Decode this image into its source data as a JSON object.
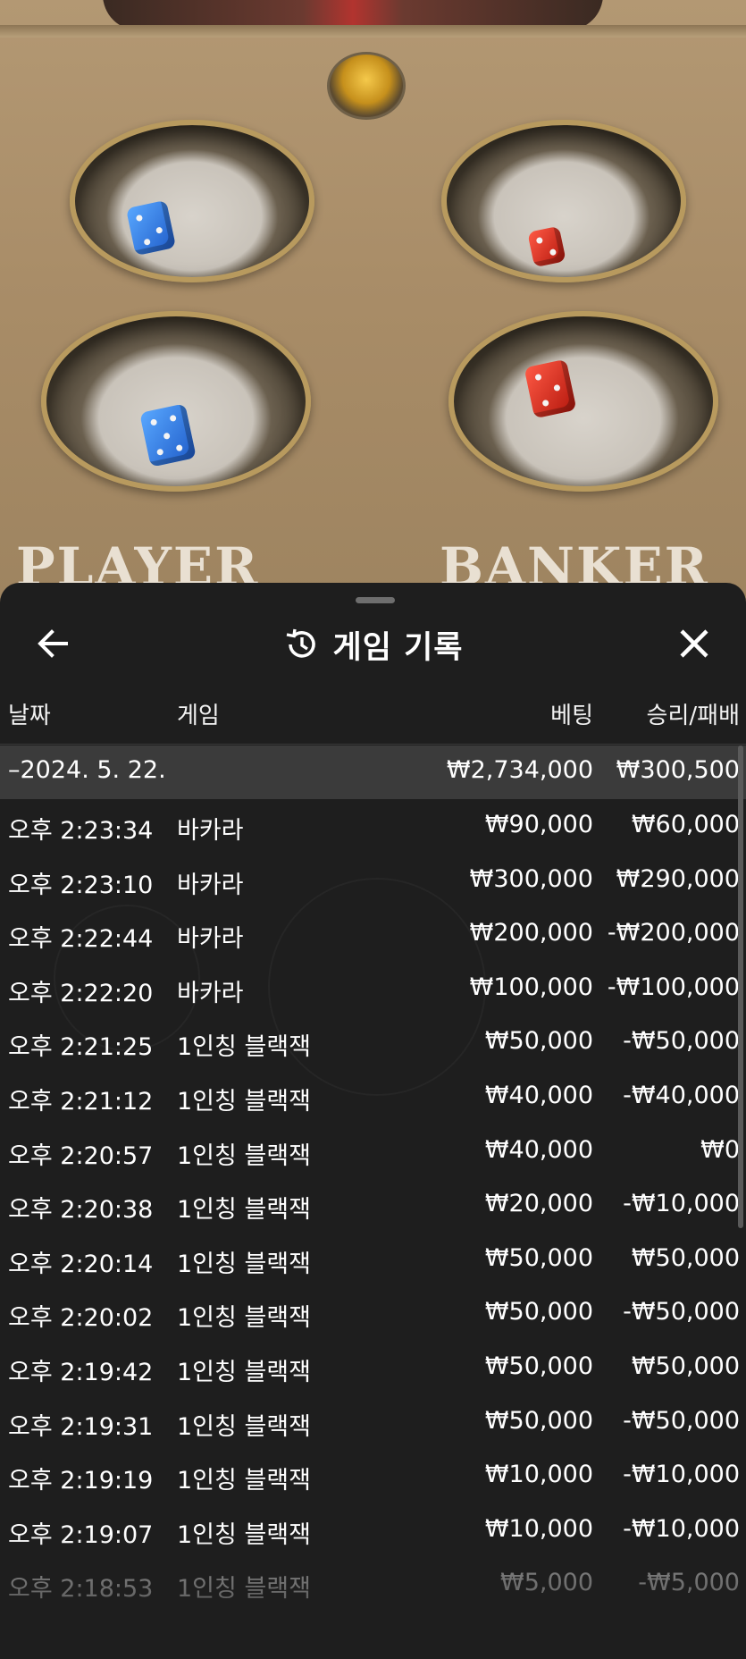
{
  "table": {
    "player_text": "PLAYER",
    "banker_text": "BANKER"
  },
  "sheet": {
    "title": "게임 기록",
    "icons": {
      "back": "arrow-left-icon",
      "history": "history-icon",
      "close": "close-icon"
    },
    "columns": {
      "date": "날짜",
      "game": "게임",
      "bet": "베팅",
      "win_loss": "승리/패배"
    },
    "date_group": {
      "label": "–2024. 5. 22.",
      "bet_total": "₩2,734,000",
      "win_total": "₩300,500"
    },
    "rows": [
      {
        "time": "오후 2:23:34",
        "game": "바카라",
        "bet": "₩90,000",
        "result": "₩60,000"
      },
      {
        "time": "오후 2:23:10",
        "game": "바카라",
        "bet": "₩300,000",
        "result": "₩290,000"
      },
      {
        "time": "오후 2:22:44",
        "game": "바카라",
        "bet": "₩200,000",
        "result": "-₩200,000"
      },
      {
        "time": "오후 2:22:20",
        "game": "바카라",
        "bet": "₩100,000",
        "result": "-₩100,000"
      },
      {
        "time": "오후 2:21:25",
        "game": "1인칭 블랙잭",
        "bet": "₩50,000",
        "result": "-₩50,000"
      },
      {
        "time": "오후 2:21:12",
        "game": "1인칭 블랙잭",
        "bet": "₩40,000",
        "result": "-₩40,000"
      },
      {
        "time": "오후 2:20:57",
        "game": "1인칭 블랙잭",
        "bet": "₩40,000",
        "result": "₩0"
      },
      {
        "time": "오후 2:20:38",
        "game": "1인칭 블랙잭",
        "bet": "₩20,000",
        "result": "-₩10,000"
      },
      {
        "time": "오후 2:20:14",
        "game": "1인칭 블랙잭",
        "bet": "₩50,000",
        "result": "₩50,000"
      },
      {
        "time": "오후 2:20:02",
        "game": "1인칭 블랙잭",
        "bet": "₩50,000",
        "result": "-₩50,000"
      },
      {
        "time": "오후 2:19:42",
        "game": "1인칭 블랙잭",
        "bet": "₩50,000",
        "result": "₩50,000"
      },
      {
        "time": "오후 2:19:31",
        "game": "1인칭 블랙잭",
        "bet": "₩50,000",
        "result": "-₩50,000"
      },
      {
        "time": "오후 2:19:19",
        "game": "1인칭 블랙잭",
        "bet": "₩10,000",
        "result": "-₩10,000"
      },
      {
        "time": "오후 2:19:07",
        "game": "1인칭 블랙잭",
        "bet": "₩10,000",
        "result": "-₩10,000"
      },
      {
        "time": "오후 2:18:53",
        "game": "1인칭 블랙잭",
        "bet": "₩5,000",
        "result": "-₩5,000"
      }
    ]
  }
}
